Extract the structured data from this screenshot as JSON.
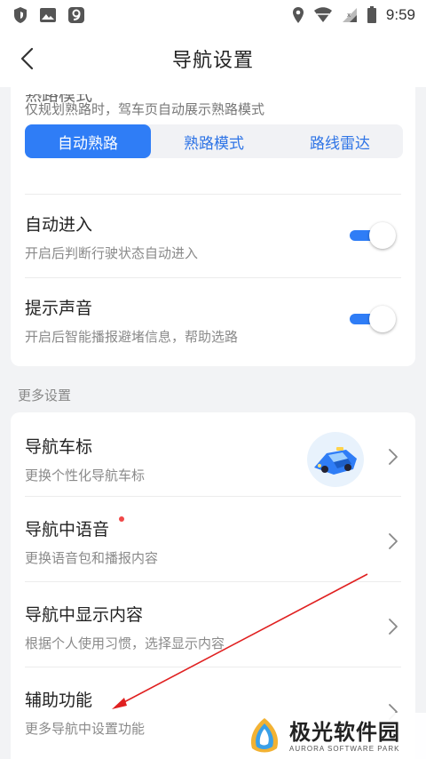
{
  "status_bar": {
    "time": "9:59"
  },
  "header": {
    "title": "导航设置"
  },
  "familiar_route": {
    "title_partial": "熟路模式",
    "hint": "仅规划熟路时，驾车页自动展示熟路模式",
    "options": [
      "自动熟路",
      "熟路模式",
      "路线雷达"
    ],
    "selected": "自动熟路"
  },
  "toggles": [
    {
      "title": "自动进入",
      "subtitle": "开启后判断行驶状态自动进入",
      "on": true
    },
    {
      "title": "提示声音",
      "subtitle": "开启后智能播报避堵信息，帮助选路",
      "on": true
    }
  ],
  "more_settings": {
    "label": "更多设置",
    "items": [
      {
        "title": "导航车标",
        "subtitle": "更换个性化导航车标",
        "icon": "car-icon"
      },
      {
        "title": "导航中语音",
        "subtitle": "更换语音包和播报内容",
        "badge": "red-dot"
      },
      {
        "title": "导航中显示内容",
        "subtitle": "根据个人使用习惯，选择显示内容"
      },
      {
        "title": "辅助功能",
        "subtitle": "更多导航中设置功能"
      }
    ]
  },
  "watermark": {
    "main": "极光软件园",
    "sub": "AURORA SOFTWARE PARK"
  },
  "colors": {
    "accent": "#2f7df6",
    "annotation": "#e02020",
    "badge": "#f04848"
  }
}
